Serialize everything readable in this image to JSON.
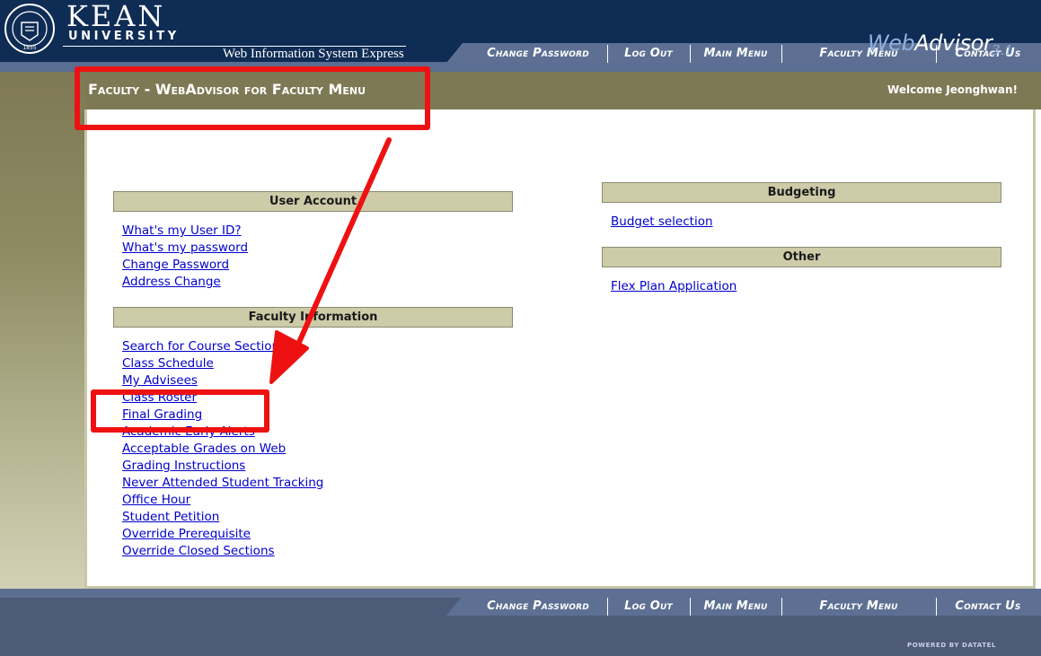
{
  "header": {
    "brand_line1": "KEAN",
    "brand_line2": "UNIVERSITY",
    "tagline": "Web Information System Express",
    "nav": [
      "Change Password",
      "Log Out",
      "Main Menu",
      "Faculty Menu",
      "Contact Us"
    ]
  },
  "page": {
    "title": "Faculty - WebAdvisor for Faculty Menu",
    "welcome": "Welcome Jeonghwan!"
  },
  "sections": {
    "user_account": {
      "title": "User Account",
      "links": [
        "What's my User ID?",
        "What's my password",
        "Change Password",
        "Address Change"
      ]
    },
    "faculty_information": {
      "title": "Faculty Information",
      "links": [
        "Search for Course Sections",
        "Class Schedule",
        "My Advisees",
        "Class Roster",
        "Final Grading",
        "Academic Early Alerts",
        "Acceptable Grades on Web",
        "Grading Instructions",
        "Never Attended Student Tracking",
        "Office Hour",
        "Student Petition",
        "Override Prerequisite",
        "Override Closed Sections"
      ]
    },
    "budgeting": {
      "title": "Budgeting",
      "links": [
        "Budget selection"
      ]
    },
    "other": {
      "title": "Other",
      "links": [
        "Flex Plan Application"
      ]
    }
  },
  "footer": {
    "nav": [
      "Change Password",
      "Log Out",
      "Main Menu",
      "Faculty Menu",
      "Contact Us"
    ],
    "brand_web": "Web",
    "brand_advisor": "Advisor",
    "brand_version": "3.1",
    "powered_by": "POWERED BY DATATEL"
  },
  "colors": {
    "header_navy": "#0f2c55",
    "nav_blue": "#5d7093",
    "olive": "#7e7955",
    "section_header": "#cdcba8",
    "link": "#0000cc",
    "annotation_red": "#ee1111"
  }
}
